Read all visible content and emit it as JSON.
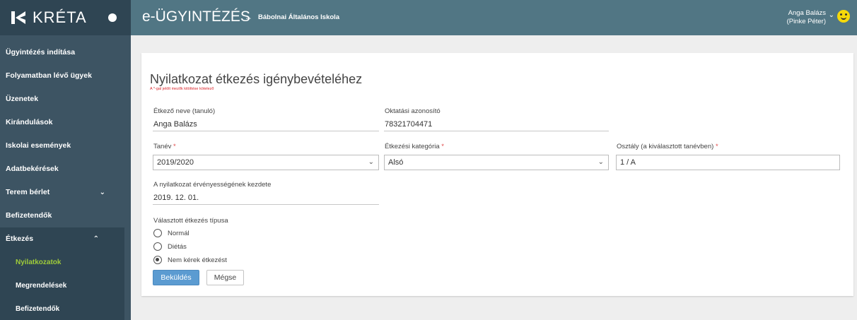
{
  "sidebar": {
    "logo_text": "KRÉTA",
    "items": [
      {
        "label": "Ügyintézés indítása"
      },
      {
        "label": "Folyamatban lévő ügyek"
      },
      {
        "label": "Üzenetek"
      },
      {
        "label": "Kirándulások"
      },
      {
        "label": "Iskolai események"
      },
      {
        "label": "Adatbekérések"
      },
      {
        "label": "Terem bérlet",
        "chevron": "⌄"
      },
      {
        "label": "Befizetendők"
      },
      {
        "label": "Étkezés",
        "chevron": "⌃"
      }
    ],
    "sub_items": [
      {
        "label": "Nyilatkozatok",
        "active": true
      },
      {
        "label": "Megrendelések"
      },
      {
        "label": "Befizetendők"
      }
    ]
  },
  "header": {
    "app_title": "e-ÜGYINTÉZÉS",
    "dash": "–",
    "school": "Bábolnai Általános Iskola",
    "user_name": "Anga Balázs",
    "user_sub": "(Pinke Péter)",
    "user_chevron": "⌄"
  },
  "form": {
    "title": "Nyilatkozat étkezés igénybevételéhez",
    "required_note": "A *-gal jelölt mezők kitöltése kötelező",
    "fields": {
      "eater_name": {
        "label": "Étkező neve (tanuló)",
        "value": "Anga Balázs"
      },
      "edu_id": {
        "label": "Oktatási azonosító",
        "value": "78321704471"
      },
      "school_year": {
        "label": "Tanév",
        "required": "*",
        "value": "2019/2020"
      },
      "meal_category": {
        "label": "Étkezési kategória",
        "required": "*",
        "value": "Alsó"
      },
      "class": {
        "label": "Osztály (a kiválasztott tanévben)",
        "required": "*",
        "value": "1 / A"
      },
      "valid_from": {
        "label": "A nyilatkozat érvényességének kezdete",
        "value": "2019. 12. 01."
      }
    },
    "meal_type": {
      "label": "Választott étkezés típusa",
      "options": [
        {
          "label": "Normál",
          "checked": false
        },
        {
          "label": "Diétás",
          "checked": false
        },
        {
          "label": "Nem kérek étkezést",
          "checked": true
        }
      ]
    },
    "buttons": {
      "submit": "Beküldés",
      "cancel": "Mégse"
    },
    "caret": "⌄"
  },
  "colors": {
    "sidebar_bg": "#3d5463",
    "topbar_bg": "#517684",
    "active_sub": "#9fcc3a",
    "primary_button": "#5b9bd1",
    "required": "#e04b4b"
  }
}
